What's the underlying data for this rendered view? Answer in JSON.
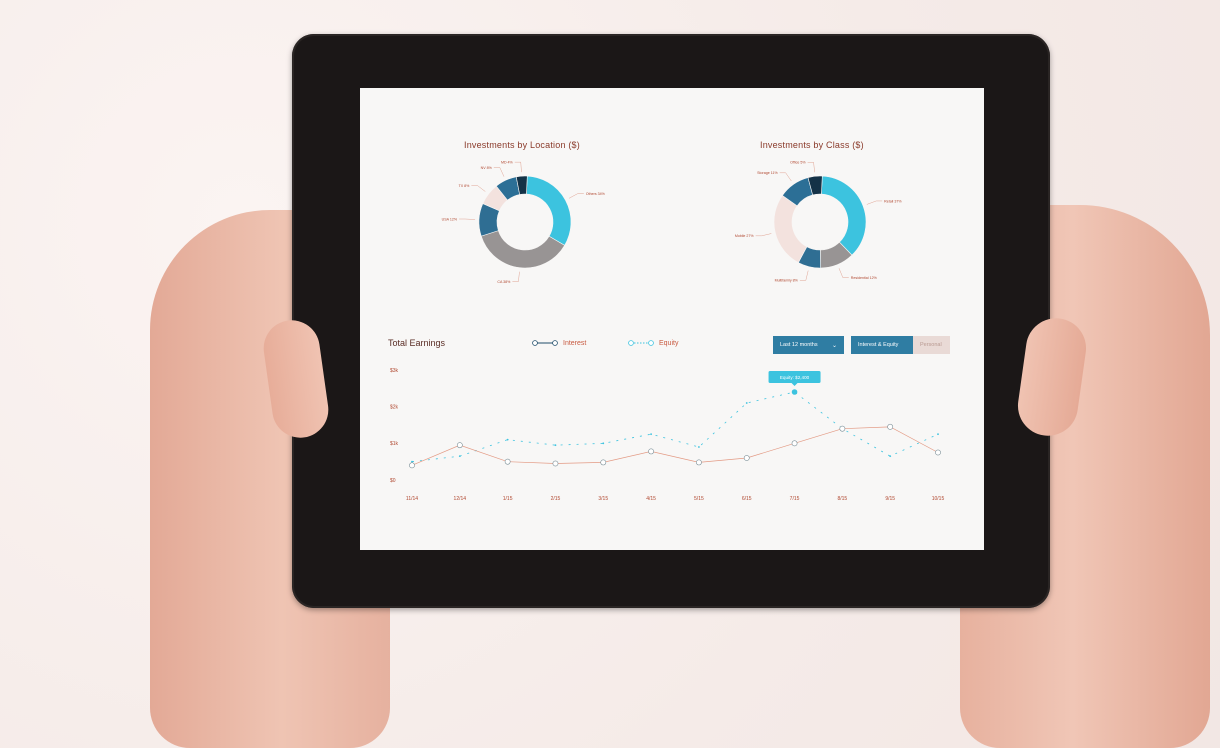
{
  "location_chart": {
    "title": "Investments by Location ($)",
    "slices": [
      {
        "label": "Others 34%",
        "value": 34,
        "color": "#3cc3df"
      },
      {
        "label": "CA 38%",
        "value": 38,
        "color": "#989494"
      },
      {
        "label": "USA 12%",
        "value": 12,
        "color": "#2f6e93"
      },
      {
        "label": "TX 8%",
        "value": 8,
        "color": "#f3e2de"
      },
      {
        "label": "NV 8%",
        "value": 8,
        "color": "#2c6f96"
      },
      {
        "label": "MD 4%",
        "value": 4,
        "color": "#143247"
      }
    ]
  },
  "class_chart": {
    "title": "Investments by Class ($)",
    "slices": [
      {
        "label": "Retail 37%",
        "value": 37,
        "color": "#3cc3df"
      },
      {
        "label": "Residential 12%",
        "value": 12,
        "color": "#989494"
      },
      {
        "label": "Multifamily 8%",
        "value": 8,
        "color": "#2f6e93"
      },
      {
        "label": "Mobile 27%",
        "value": 27,
        "color": "#f3e2de"
      },
      {
        "label": "Storage 11%",
        "value": 11,
        "color": "#2c6f96"
      },
      {
        "label": "Office 5%",
        "value": 5,
        "color": "#143247"
      }
    ]
  },
  "earnings": {
    "title": "Total Earnings",
    "legend_interest": "Interest",
    "legend_equity": "Equity",
    "months_button": "Last 12 months",
    "interest_equity_button": "Interest & Equity",
    "personal_button": "Personal",
    "tooltip": "Equity: $2,400"
  },
  "chart_data": {
    "type": "line",
    "title": "Total Earnings",
    "x": [
      "11/14",
      "12/14",
      "1/15",
      "2/15",
      "3/15",
      "4/15",
      "5/15",
      "6/15",
      "7/15",
      "8/15",
      "9/15",
      "10/15"
    ],
    "y_ticks": [
      "$3k",
      "$2k",
      "$1k",
      "$0"
    ],
    "ylim": [
      0,
      3000
    ],
    "series": [
      {
        "name": "Interest",
        "values": [
          400,
          950,
          500,
          450,
          480,
          780,
          480,
          600,
          1000,
          1400,
          1450,
          750
        ]
      },
      {
        "name": "Equity",
        "values": [
          500,
          650,
          1100,
          950,
          1000,
          1250,
          900,
          2100,
          2400,
          1400,
          650,
          1250
        ]
      }
    ],
    "legend": "top"
  },
  "colors": {
    "accent": "#3cc3df",
    "brand_dark": "#2f7da3",
    "text_red": "#b0472f"
  }
}
